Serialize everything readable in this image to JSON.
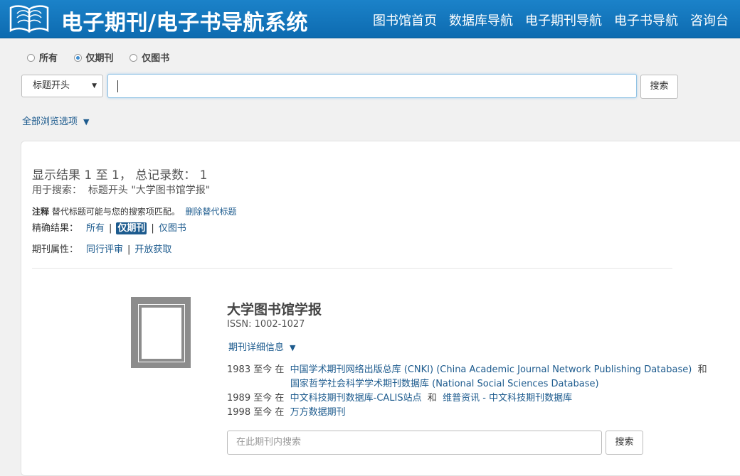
{
  "header": {
    "title": "电子期刊/电子书导航系统",
    "nav": [
      "图书馆首页",
      "数据库导航",
      "电子期刊导航",
      "电子书导航",
      "咨询台"
    ]
  },
  "search": {
    "scope_options": [
      {
        "label": "所有",
        "selected": false
      },
      {
        "label": "仅期刊",
        "selected": true
      },
      {
        "label": "仅图书",
        "selected": false
      }
    ],
    "field_select": "标题开头",
    "query": "",
    "search_button": "搜索",
    "browse_all": "全部浏览选项"
  },
  "results": {
    "count_line": "显示结果 1 至 1， 总记录数： 1",
    "used_search_label": "用于搜索：",
    "used_search_value": "标题开头 \"大学图书馆学报\"",
    "note_label": "注释",
    "note_text": "替代标题可能与您的搜索项匹配。",
    "note_link": "删除替代标题",
    "refine_label": "精确结果：",
    "refine_options": [
      "所有",
      "仅期刊",
      "仅图书"
    ],
    "refine_active": "仅期刊",
    "attr_label": "期刊属性：",
    "attr_options": [
      "同行评审",
      "开放获取"
    ]
  },
  "record": {
    "title": "大学图书馆学报",
    "issn": "ISSN: 1002-1027",
    "details_link": "期刊详细信息",
    "coverage": [
      {
        "range": "1983 至今 在",
        "links": [
          "中国学术期刊网络出版总库 (CNKI) (China Academic Journal Network Publishing Database)",
          "国家哲学社会科学学术期刊数据库 (National Social Sciences Database)"
        ],
        "joiner": "和"
      },
      {
        "range": "1989 至今 在",
        "links": [
          "中文科技期刊数据库-CALIS站点",
          "维普资讯 - 中文科技期刊数据库"
        ],
        "joiner": "和"
      },
      {
        "range": "1998 至今 在",
        "links": [
          "万方数据期刊"
        ],
        "joiner": ""
      }
    ],
    "in_search_placeholder": "在此期刊内搜索",
    "in_search_button": "搜索"
  }
}
